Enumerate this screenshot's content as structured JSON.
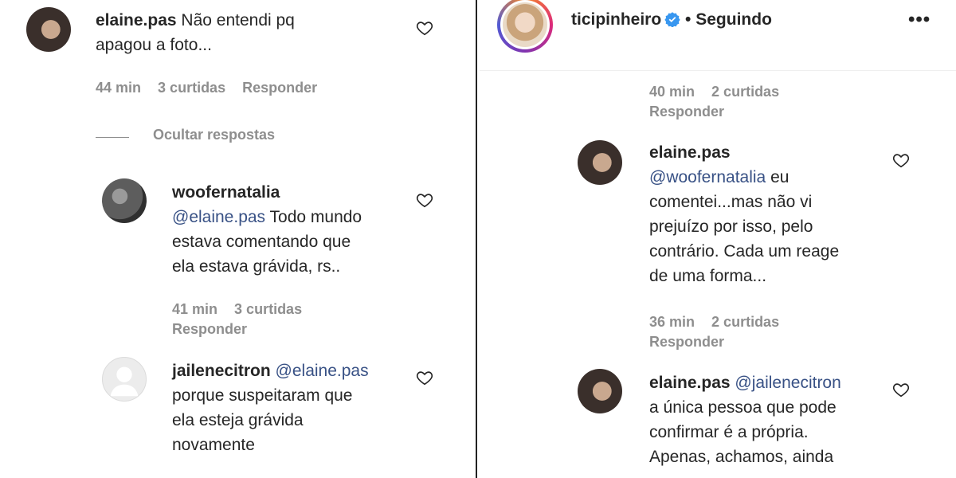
{
  "left": {
    "comments": [
      {
        "username": "elaine.pas",
        "text_lines": [
          "Não entendi pq",
          "apagou a foto..."
        ],
        "meta": {
          "time": "44 min",
          "likes": "3 curtidas",
          "reply": "Responder"
        }
      }
    ],
    "hide_replies": "Ocultar respostas",
    "replies": [
      {
        "username": "woofernatalia",
        "mention": "@elaine.pas",
        "text_first": "Todo mundo",
        "text_lines": [
          "estava comentando que",
          "ela estava grávida, rs.."
        ],
        "meta": {
          "time": "41 min",
          "likes": "3 curtidas",
          "reply": "Responder"
        }
      },
      {
        "username": "jailenecitron",
        "mention": "@elaine.pas",
        "text_lines": [
          "porque suspeitaram que",
          "ela esteja grávida",
          "novamente"
        ]
      }
    ]
  },
  "right": {
    "header": {
      "username": "ticipinheiro",
      "separator": "•",
      "follow_state": "Seguindo",
      "more": "•••"
    },
    "top_meta": {
      "time": "40 min",
      "likes": "2 curtidas",
      "reply": "Responder"
    },
    "comments": [
      {
        "username": "elaine.pas",
        "mention": "@woofernatalia",
        "mention_after": "eu",
        "text_lines": [
          "comentei...mas não vi",
          "prejuízo por isso, pelo",
          "contrário. Cada um reage",
          "de uma forma..."
        ],
        "meta": {
          "time": "36 min",
          "likes": "2 curtidas",
          "reply": "Responder"
        }
      },
      {
        "username": "elaine.pas",
        "mention": "@jailenecitron",
        "text_lines": [
          "a única pessoa que pode",
          "confirmar é a própria.",
          "Apenas, achamos, ainda"
        ]
      }
    ]
  },
  "colors": {
    "text": "#262626",
    "meta": "#8e8e8e",
    "mention": "#385185",
    "verified": "#3897f0"
  },
  "icons": [
    "heart-icon",
    "verified-badge-icon",
    "more-options-icon"
  ]
}
